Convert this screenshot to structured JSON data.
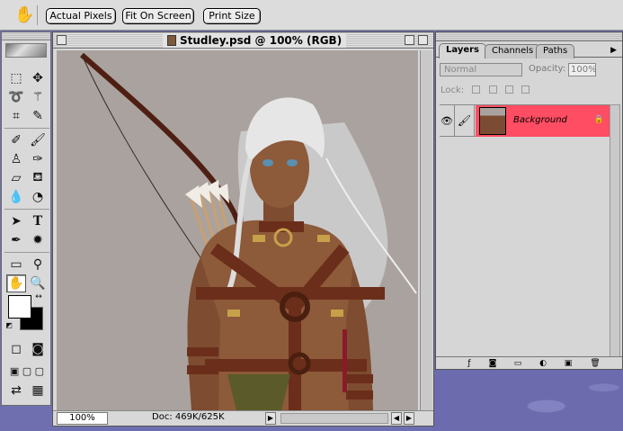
{
  "options_bar": {
    "buttons": [
      "Actual Pixels",
      "Fit On Screen",
      "Print Size"
    ]
  },
  "document": {
    "title": "Studley.psd @ 100% (RGB)",
    "zoom": "100%",
    "doc_size": "Doc: 469K/625K"
  },
  "layers_palette": {
    "tabs": [
      "Layers",
      "Channels",
      "Paths"
    ],
    "blend_mode": "Normal",
    "opacity_label": "Opacity:",
    "opacity_value": "100%",
    "lock_label": "Lock:",
    "layers": [
      {
        "name": "Background",
        "visible": true,
        "selected": true,
        "locked": true
      }
    ]
  },
  "colors": {
    "desktop": "#6f6fb0",
    "chrome": "#d8d8d8",
    "canvas_bg": "#aaa29e",
    "layer_selected": "#ff4d63",
    "skin": "#8d5a3a",
    "strap": "#6b2e1a"
  },
  "icons": [
    "hand-icon",
    "marquee-icon",
    "move-icon",
    "lasso-icon",
    "magic-wand-icon",
    "crop-icon",
    "slice-icon",
    "healing-icon",
    "brush-icon",
    "stamp-icon",
    "history-brush-icon",
    "eraser-icon",
    "bucket-icon",
    "blur-icon",
    "dodge-icon",
    "path-select-icon",
    "type-icon",
    "pen-icon",
    "shape-icon",
    "notes-icon",
    "eyedropper-icon",
    "hand-tool-icon",
    "zoom-icon"
  ]
}
